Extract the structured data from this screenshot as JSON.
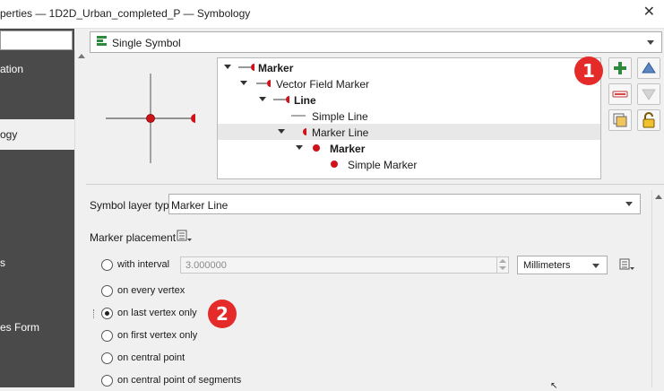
{
  "window": {
    "title": "perties — 1D2D_Urban_completed_P — Symbology",
    "close_glyph": "✕"
  },
  "sidebar": {
    "search_placeholder": "",
    "items": [
      {
        "label": "ation",
        "active": false
      },
      {
        "label": "ogy",
        "active": true
      },
      {
        "label": "s",
        "active": false
      },
      {
        "label": "es Form",
        "active": false
      }
    ]
  },
  "renderer": {
    "selected": "Single Symbol",
    "icon": "single-symbol-icon"
  },
  "symbol_tree": {
    "rows": [
      {
        "label": "Marker",
        "bold": true,
        "expanded": true,
        "selected": false,
        "symbol": "marker-line-symbol-icon"
      },
      {
        "label": "Vector Field Marker",
        "bold": false,
        "expanded": true,
        "selected": false,
        "symbol": "vector-field-marker-icon"
      },
      {
        "label": "Line",
        "bold": true,
        "expanded": true,
        "selected": false,
        "symbol": "marker-line-symbol-icon"
      },
      {
        "label": "Simple Line",
        "bold": false,
        "expanded": false,
        "selected": false,
        "symbol": "simple-line-icon"
      },
      {
        "label": "Marker Line",
        "bold": false,
        "expanded": true,
        "selected": true,
        "symbol": "half-circle-marker-icon"
      },
      {
        "label": "Marker",
        "bold": true,
        "expanded": true,
        "selected": false,
        "symbol": "red-dot-icon"
      },
      {
        "label": "Simple Marker",
        "bold": false,
        "expanded": false,
        "selected": false,
        "symbol": "red-dot-icon"
      }
    ]
  },
  "side_buttons": [
    {
      "name": "add-symbol-layer-button",
      "icon": "plus-icon"
    },
    {
      "name": "move-up-button",
      "icon": "arrow-up-icon"
    },
    {
      "name": "remove-symbol-layer-button",
      "icon": "minus-icon"
    },
    {
      "name": "move-down-button",
      "icon": "arrow-down-icon"
    },
    {
      "name": "duplicate-layer-button",
      "icon": "duplicate-icon"
    },
    {
      "name": "lock-layer-button",
      "icon": "lock-icon"
    }
  ],
  "badges": {
    "one": "1",
    "two": "2"
  },
  "layer_properties": {
    "layer_type_label": "Symbol layer type",
    "layer_type_value": "Marker Line",
    "placement_label": "Marker placement",
    "interval_label": "with interval",
    "interval_value": "3.000000",
    "unit_value": "Millimeters",
    "options": [
      {
        "label": "on every vertex",
        "checked": false
      },
      {
        "label": "on last vertex only",
        "checked": true
      },
      {
        "label": "on first vertex only",
        "checked": false
      },
      {
        "label": "on central point",
        "checked": false
      },
      {
        "label": "on central point of segments",
        "checked": false
      }
    ]
  },
  "colors": {
    "accent_green": "#2d8a3e",
    "marker_red": "#d0121b",
    "badge_red": "#e52a2a",
    "sidebar_dark": "#4a4a4a",
    "selection_gray": "#e8e8e8"
  }
}
